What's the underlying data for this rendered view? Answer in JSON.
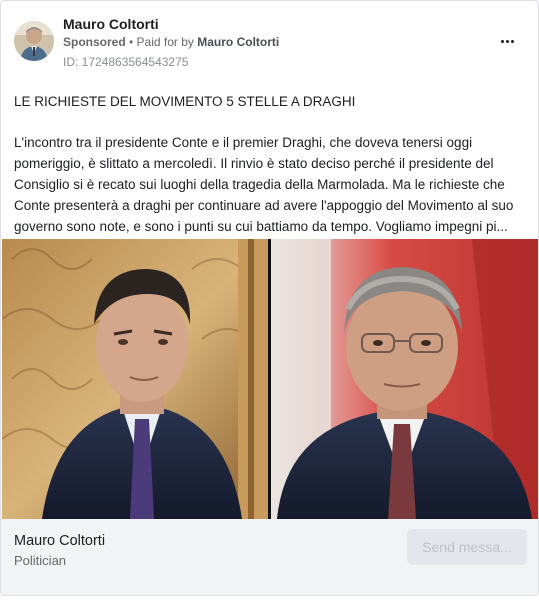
{
  "ad": {
    "page_name": "Mauro Coltorti",
    "sponsored_label": "Sponsored",
    "separator": " • ",
    "paid_for_prefix": "Paid for by ",
    "paid_for_name": "Mauro Coltorti",
    "id_text": "ID: 1724863564543275",
    "more_icon": "more-horizontal-icon"
  },
  "post": {
    "headline": "LE RICHIESTE DEL MOVIMENTO 5 STELLE A DRAGHI",
    "body": "L'incontro tra il presidente Conte e il premier Draghi, che doveva tenersi oggi pomeriggio, è slittato a mercoledì. Il rinvio è stato deciso perché il presidente del Consiglio si è recato sui luoghi della tragedia della Marmolada. Ma le richieste che Conte presenterà a draghi per continuare ad avere l'appoggio del Movimento al suo governo sono note, e sono i punti su cui battiamo da tempo. Vogliamo impegni pi..."
  },
  "footer": {
    "name": "Mauro Coltorti",
    "category": "Politician",
    "cta_label": "Send messa..."
  }
}
